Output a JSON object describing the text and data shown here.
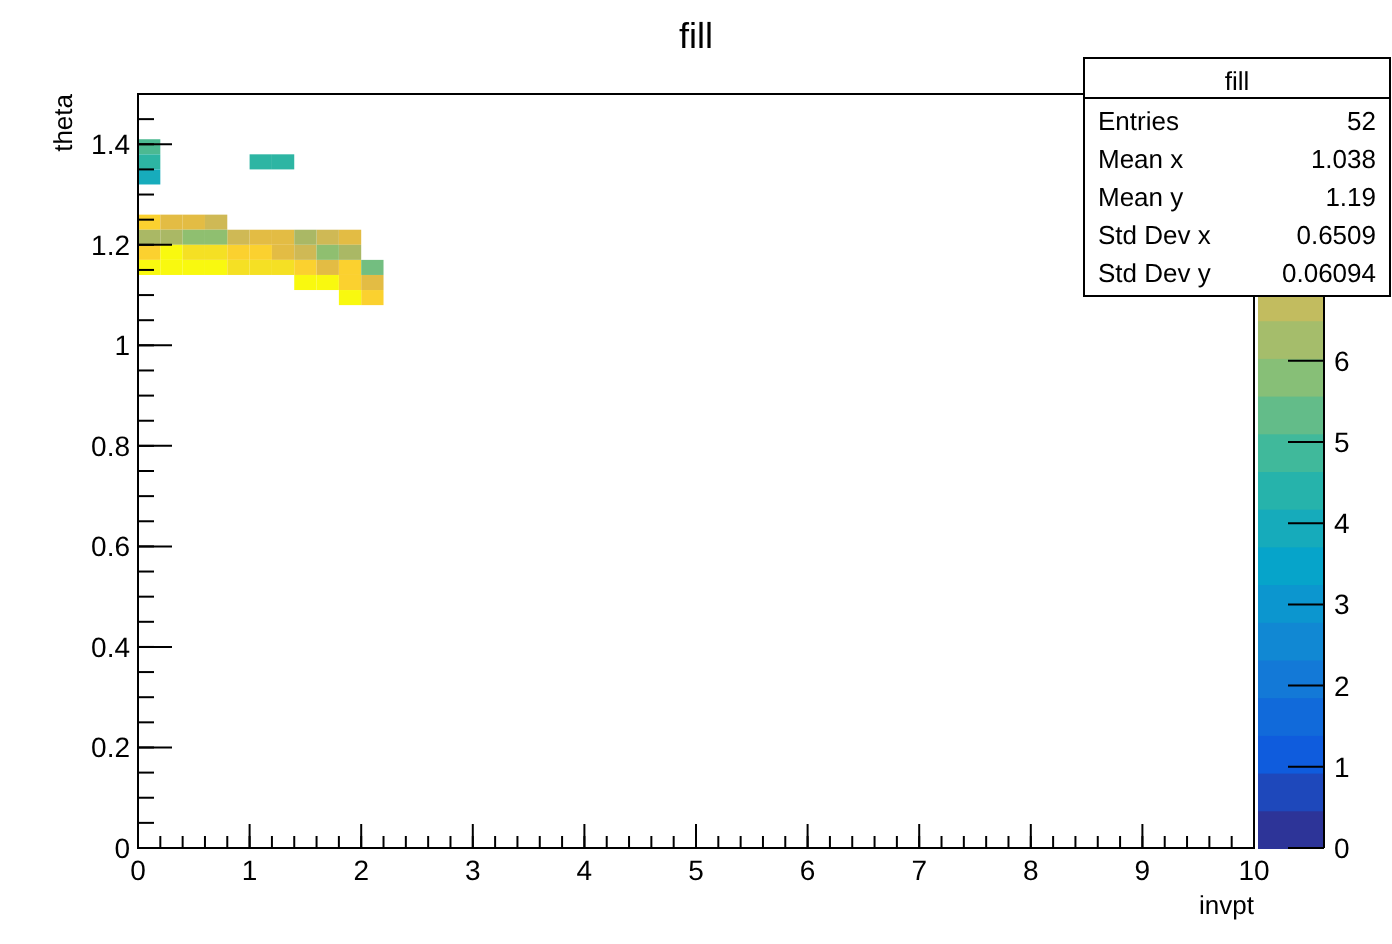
{
  "canvas": {
    "chart_data": {
      "type": "scatter",
      "title": "fill",
      "xlabel": "invpt",
      "ylabel": "theta",
      "xlim": [
        0,
        10
      ],
      "ylim": [
        0,
        1.5
      ],
      "xticks": [
        0,
        1,
        2,
        3,
        4,
        5,
        6,
        7,
        8,
        9,
        10
      ],
      "yticks": [
        0,
        0.2,
        0.4,
        0.6,
        0.8,
        1,
        1.2,
        1.4
      ],
      "x": [
        0.1,
        0.1,
        1.1,
        1.3,
        0.1,
        0.1,
        0.1,
        0.9,
        1.1,
        1.5,
        1.9,
        1.9,
        2.1,
        0.3,
        0.5,
        1.1,
        1.3,
        1.9,
        1.3,
        1.7,
        2.1,
        0.7,
        0.9,
        1.7,
        1.5,
        0.1,
        0.3,
        1.5,
        1.9,
        0.5,
        0.7,
        1.7,
        2.1,
        0.3,
        0.1,
        0.3,
        0.5,
        0.7,
        1.5,
        1.7,
        1.9,
        0.5,
        0.7,
        0.9,
        1.1,
        1.3
      ],
      "series": [
        {
          "color": "#4cb992",
          "values": [
            1.395,
            null,
            null,
            null,
            null,
            null,
            null,
            null,
            null,
            null,
            null,
            null,
            null,
            null,
            null,
            null,
            null,
            null,
            null,
            null,
            null,
            null,
            null,
            null,
            null,
            null,
            null,
            null,
            null,
            null,
            null,
            null,
            null,
            null,
            null,
            null,
            null,
            null,
            null,
            null,
            null,
            null,
            null,
            null,
            null,
            null
          ]
        },
        {
          "color": "#2db5a3",
          "values": [
            null,
            1.365,
            1.365,
            1.365,
            null,
            null,
            null,
            null,
            null,
            null,
            null,
            null,
            null,
            null,
            null,
            null,
            null,
            null,
            null,
            null,
            null,
            null,
            null,
            null,
            null,
            null,
            null,
            null,
            null,
            null,
            null,
            null,
            null,
            null,
            null,
            null,
            null,
            null,
            null,
            null,
            null,
            null,
            null,
            null,
            null,
            null
          ]
        },
        {
          "color": "#17acbc",
          "values": [
            null,
            null,
            null,
            null,
            1.335,
            null,
            null,
            null,
            null,
            null,
            null,
            null,
            null,
            null,
            null,
            null,
            null,
            null,
            null,
            null,
            null,
            null,
            null,
            null,
            null,
            null,
            null,
            null,
            null,
            null,
            null,
            null,
            null,
            null,
            null,
            null,
            null,
            null,
            null,
            null,
            null,
            null,
            null,
            null,
            null,
            null
          ]
        },
        {
          "color": "#fbd12f",
          "values": [
            null,
            null,
            null,
            null,
            null,
            1.245,
            1.185,
            1.185,
            1.185,
            1.155,
            1.155,
            1.125,
            1.095,
            null,
            null,
            null,
            null,
            null,
            null,
            null,
            null,
            null,
            null,
            null,
            null,
            null,
            null,
            null,
            null,
            null,
            null,
            null,
            null,
            null,
            null,
            null,
            null,
            null,
            null,
            null,
            null,
            null,
            null,
            null,
            null,
            null
          ]
        },
        {
          "color": "#e3bc44",
          "values": [
            null,
            null,
            null,
            null,
            null,
            null,
            null,
            null,
            null,
            null,
            null,
            null,
            null,
            1.245,
            1.245,
            1.215,
            1.215,
            1.215,
            1.185,
            1.155,
            1.125,
            null,
            null,
            null,
            null,
            null,
            null,
            null,
            null,
            null,
            null,
            null,
            null,
            null,
            null,
            null,
            null,
            null,
            null,
            null,
            null,
            null,
            null,
            null,
            null,
            null
          ]
        },
        {
          "color": "#cfb955",
          "values": [
            null,
            null,
            null,
            null,
            null,
            null,
            null,
            null,
            null,
            null,
            null,
            null,
            null,
            null,
            null,
            null,
            null,
            null,
            null,
            null,
            null,
            1.245,
            1.215,
            1.215,
            1.185,
            null,
            null,
            null,
            null,
            null,
            null,
            null,
            null,
            null,
            null,
            null,
            null,
            null,
            null,
            null,
            null,
            null,
            null,
            null,
            null,
            null
          ]
        },
        {
          "color": "#aab865",
          "values": [
            null,
            null,
            null,
            null,
            null,
            null,
            null,
            null,
            null,
            null,
            null,
            null,
            null,
            null,
            null,
            null,
            null,
            null,
            null,
            null,
            null,
            null,
            null,
            null,
            null,
            1.215,
            1.215,
            1.215,
            1.185,
            null,
            null,
            null,
            null,
            null,
            null,
            null,
            null,
            null,
            null,
            null,
            null,
            null,
            null,
            null,
            null,
            null
          ]
        },
        {
          "color": "#8fbf70",
          "values": [
            null,
            null,
            null,
            null,
            null,
            null,
            null,
            null,
            null,
            null,
            null,
            null,
            null,
            null,
            null,
            null,
            null,
            null,
            null,
            null,
            null,
            null,
            null,
            null,
            null,
            null,
            null,
            null,
            null,
            1.215,
            1.215,
            1.185,
            null,
            null,
            null,
            null,
            null,
            null,
            null,
            null,
            null,
            null,
            null,
            null,
            null,
            null
          ]
        },
        {
          "color": "#73be80",
          "values": [
            null,
            null,
            null,
            null,
            null,
            null,
            null,
            null,
            null,
            null,
            null,
            null,
            null,
            null,
            null,
            null,
            null,
            null,
            null,
            null,
            null,
            null,
            null,
            null,
            null,
            null,
            null,
            null,
            null,
            null,
            null,
            null,
            1.155,
            null,
            null,
            null,
            null,
            null,
            null,
            null,
            null,
            null,
            null,
            null,
            null,
            null
          ]
        },
        {
          "color": "#f9f90f",
          "values": [
            null,
            null,
            null,
            null,
            null,
            null,
            null,
            null,
            null,
            null,
            null,
            null,
            null,
            null,
            null,
            null,
            null,
            null,
            null,
            null,
            null,
            null,
            null,
            null,
            null,
            null,
            null,
            null,
            null,
            null,
            null,
            null,
            null,
            1.185,
            1.155,
            1.155,
            1.155,
            1.155,
            1.125,
            1.125,
            1.095,
            null,
            null,
            null,
            null,
            null
          ]
        },
        {
          "color": "#f5e024",
          "values": [
            null,
            null,
            null,
            null,
            null,
            null,
            null,
            null,
            null,
            null,
            null,
            null,
            null,
            null,
            null,
            null,
            null,
            null,
            null,
            null,
            null,
            null,
            null,
            null,
            null,
            null,
            null,
            null,
            null,
            null,
            null,
            null,
            null,
            null,
            null,
            null,
            null,
            null,
            null,
            null,
            null,
            1.185,
            1.185,
            1.155,
            1.155,
            1.155
          ]
        }
      ]
    },
    "color_axis": {
      "labels": [
        "6",
        "5",
        "4",
        "3",
        "2",
        "1",
        "0"
      ]
    },
    "stats": {
      "title": "fill",
      "rows": [
        {
          "label": "Entries",
          "value": "52"
        },
        {
          "label": "Mean x",
          "value": "1.038"
        },
        {
          "label": "Mean y",
          "value": "1.19"
        },
        {
          "label": "Std Dev x",
          "value": "0.6509"
        },
        {
          "label": "Std Dev y",
          "value": "0.06094"
        }
      ]
    }
  }
}
